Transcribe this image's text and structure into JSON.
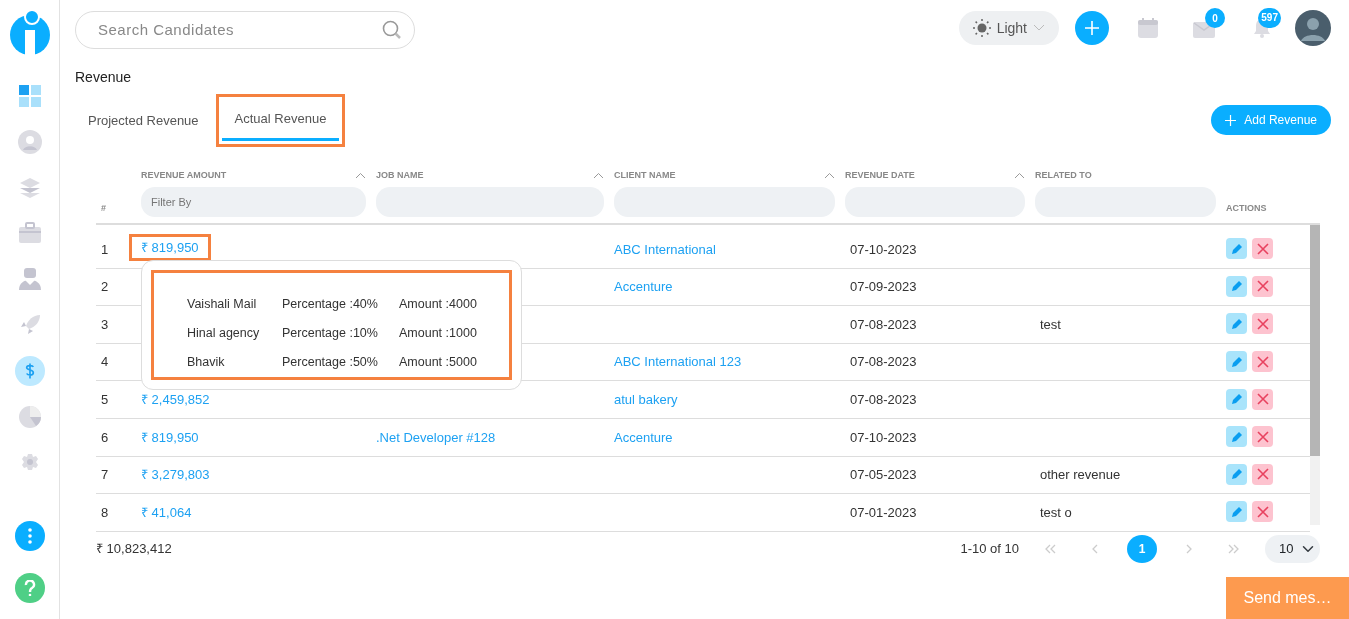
{
  "sidebar": {
    "items": [
      {
        "kind": "dashboard",
        "selected": false
      },
      {
        "kind": "person",
        "selected": false
      },
      {
        "kind": "layers",
        "selected": false
      },
      {
        "kind": "briefcase",
        "selected": false
      },
      {
        "kind": "worker",
        "selected": false
      },
      {
        "kind": "rocket",
        "selected": false
      },
      {
        "kind": "dollar",
        "selected": true
      },
      {
        "kind": "pie",
        "selected": false
      },
      {
        "kind": "gear",
        "selected": false
      }
    ]
  },
  "search": {
    "placeholder": "Search Candidates"
  },
  "theme_toggle": {
    "label": "Light"
  },
  "header_badges": {
    "messages": "0",
    "notifications": "597"
  },
  "page_title": "Revenue",
  "tabs": [
    {
      "label": "Projected Revenue",
      "selected": false,
      "highlighted": false
    },
    {
      "label": "Actual Revenue",
      "selected": true,
      "highlighted": true
    }
  ],
  "add_button": {
    "label": "Add Revenue"
  },
  "table": {
    "columns": [
      {
        "label": "#"
      },
      {
        "label": "REVENUE AMOUNT",
        "sortable": true,
        "filter_placeholder": "Filter By"
      },
      {
        "label": "JOB NAME",
        "sortable": true
      },
      {
        "label": "CLIENT NAME",
        "sortable": true
      },
      {
        "label": "REVENUE DATE",
        "sortable": true
      },
      {
        "label": "RELATED TO",
        "sortable": false
      },
      {
        "label": "ACTIONS"
      }
    ],
    "rows": [
      {
        "number": "1",
        "amount": "₹ 819,950",
        "amount_highlighted": true,
        "client": "ABC International",
        "date": "07-10-2023"
      },
      {
        "number": "2",
        "client": "Accenture",
        "date": "07-09-2023"
      },
      {
        "number": "3",
        "date": "07-08-2023",
        "related_to": "test"
      },
      {
        "number": "4",
        "client": "ABC International 123",
        "date": "07-08-2023"
      },
      {
        "number": "5",
        "amount": "₹ 2,459,852",
        "client": "atul bakery",
        "date": "07-08-2023"
      },
      {
        "number": "6",
        "amount": "₹ 819,950",
        "job_name": ".Net Developer #128",
        "client": "Accenture",
        "date": "07-10-2023"
      },
      {
        "number": "7",
        "amount": "₹ 3,279,803",
        "date": "07-05-2023",
        "related_to": "other revenue"
      },
      {
        "number": "8",
        "amount": "₹ 41,064",
        "date": "07-01-2023",
        "related_to": "test o"
      }
    ]
  },
  "popover": {
    "highlighted": true,
    "entries": [
      {
        "name": "Vaishali Mail",
        "percentage": "Percentage :40%",
        "amount": "Amount :4000"
      },
      {
        "name": "Hinal agency",
        "percentage": "Percentage :10%",
        "amount": "Amount :1000"
      },
      {
        "name": "Bhavik",
        "percentage": "Percentage :50%",
        "amount": "Amount :5000"
      }
    ]
  },
  "footer": {
    "total": "₹ 10,823,412",
    "range": "1-10 of 10",
    "pager": [
      {
        "kind": "first",
        "disabled": true
      },
      {
        "kind": "prev",
        "disabled": true
      },
      {
        "kind": "page",
        "label": "1",
        "selected": true
      },
      {
        "kind": "next",
        "disabled": true
      },
      {
        "kind": "last",
        "disabled": true
      }
    ],
    "page_size": "10"
  },
  "chat_button": {
    "label": "Send mes…"
  }
}
